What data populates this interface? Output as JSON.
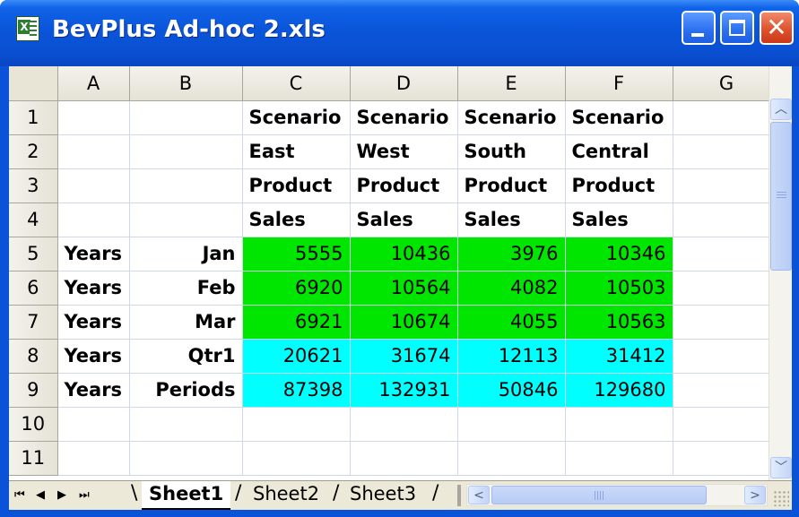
{
  "window": {
    "title": "BevPlus Ad-hoc 2.xls",
    "app_icon": "excel-icon",
    "controls": {
      "minimize_icon": "minimize-icon",
      "maximize_icon": "maximize-icon",
      "close_icon": "close-icon",
      "close_glyph": "✕"
    }
  },
  "grid": {
    "columns": [
      "A",
      "B",
      "C",
      "D",
      "E",
      "F",
      "G"
    ],
    "rows": [
      {
        "num": "1",
        "cells": [
          "",
          "",
          "Scenario",
          "Scenario",
          "Scenario",
          "Scenario",
          ""
        ]
      },
      {
        "num": "2",
        "cells": [
          "",
          "",
          "East",
          "West",
          "South",
          "Central",
          ""
        ]
      },
      {
        "num": "3",
        "cells": [
          "",
          "",
          "Product",
          "Product",
          "Product",
          "Product",
          ""
        ]
      },
      {
        "num": "4",
        "cells": [
          "",
          "",
          "Sales",
          "Sales",
          "Sales",
          "Sales",
          ""
        ]
      },
      {
        "num": "5",
        "cells": [
          "Years",
          "Jan",
          "5555",
          "10436",
          "3976",
          "10346",
          ""
        ]
      },
      {
        "num": "6",
        "cells": [
          "Years",
          "Feb",
          "6920",
          "10564",
          "4082",
          "10503",
          ""
        ]
      },
      {
        "num": "7",
        "cells": [
          "Years",
          "Mar",
          "6921",
          "10674",
          "4055",
          "10563",
          ""
        ]
      },
      {
        "num": "8",
        "cells": [
          "Years",
          "Qtr1",
          "20621",
          "31674",
          "12113",
          "31412",
          ""
        ]
      },
      {
        "num": "9",
        "cells": [
          "Years",
          "Periods",
          "87398",
          "132931",
          "50846",
          "129680",
          ""
        ]
      },
      {
        "num": "10",
        "cells": [
          "",
          "",
          "",
          "",
          "",
          "",
          ""
        ]
      },
      {
        "num": "11",
        "cells": [
          "",
          "",
          "",
          "",
          "",
          "",
          ""
        ]
      }
    ],
    "fill_colors": {
      "month_data": "#00e600",
      "total_data": "#00ffff"
    }
  },
  "sheet_tabs": {
    "active": "Sheet1",
    "tabs": [
      "Sheet1",
      "Sheet2",
      "Sheet3"
    ],
    "nav_icons": {
      "first": "⏮",
      "prev": "◀",
      "next": "▶",
      "last": "⏭"
    }
  },
  "scrollbars": {
    "up_glyph": "︿",
    "down_glyph": "﹀",
    "left_glyph": "<",
    "right_glyph": ">"
  }
}
